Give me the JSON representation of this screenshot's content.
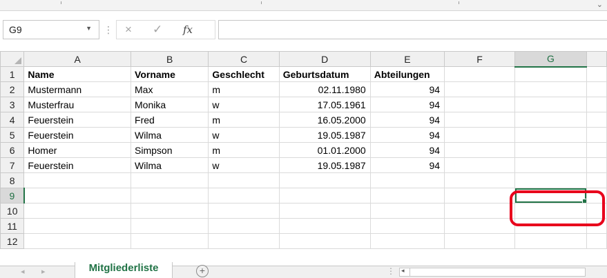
{
  "formula_bar": {
    "name_box": "G9",
    "cancel_icon": "×",
    "enter_icon": "✓",
    "fx_label": "fx",
    "formula_value": ""
  },
  "columns": [
    "A",
    "B",
    "C",
    "D",
    "E",
    "F",
    "G"
  ],
  "selected_column": "G",
  "selected_row": "9",
  "rows": [
    {
      "num": "1",
      "cells": [
        "Name",
        "Vorname",
        "Geschlecht",
        "Geburtsdatum",
        "Abteilungen",
        "",
        ""
      ]
    },
    {
      "num": "2",
      "cells": [
        "Mustermann",
        "Max",
        "m",
        "02.11.1980",
        "94",
        "",
        ""
      ]
    },
    {
      "num": "3",
      "cells": [
        "Musterfrau",
        "Monika",
        "w",
        "17.05.1961",
        "94",
        "",
        ""
      ]
    },
    {
      "num": "4",
      "cells": [
        "Feuerstein",
        "Fred",
        "m",
        "16.05.2000",
        "94",
        "",
        ""
      ]
    },
    {
      "num": "5",
      "cells": [
        "Feuerstein",
        "Wilma",
        "w",
        "19.05.1987",
        "94",
        "",
        ""
      ]
    },
    {
      "num": "6",
      "cells": [
        "Homer",
        "Simpson",
        "m",
        "01.01.2000",
        "94",
        "",
        ""
      ]
    },
    {
      "num": "7",
      "cells": [
        "Feuerstein",
        "Wilma",
        "w",
        "19.05.1987",
        "94",
        "",
        ""
      ]
    },
    {
      "num": "8",
      "cells": [
        "",
        "",
        "",
        "",
        "",
        "",
        ""
      ]
    },
    {
      "num": "9",
      "cells": [
        "",
        "",
        "",
        "",
        "",
        "",
        ""
      ]
    },
    {
      "num": "10",
      "cells": [
        "",
        "",
        "",
        "",
        "",
        "",
        ""
      ]
    },
    {
      "num": "11",
      "cells": [
        "",
        "",
        "",
        "",
        "",
        "",
        ""
      ]
    },
    {
      "num": "12",
      "cells": [
        "",
        "",
        "",
        "",
        "",
        "",
        ""
      ]
    }
  ],
  "sheet_tabs": {
    "active_tab": "Mitgliederliste",
    "add_label": "+"
  },
  "colors": {
    "accent": "#217346",
    "highlight": "#e8001c"
  }
}
